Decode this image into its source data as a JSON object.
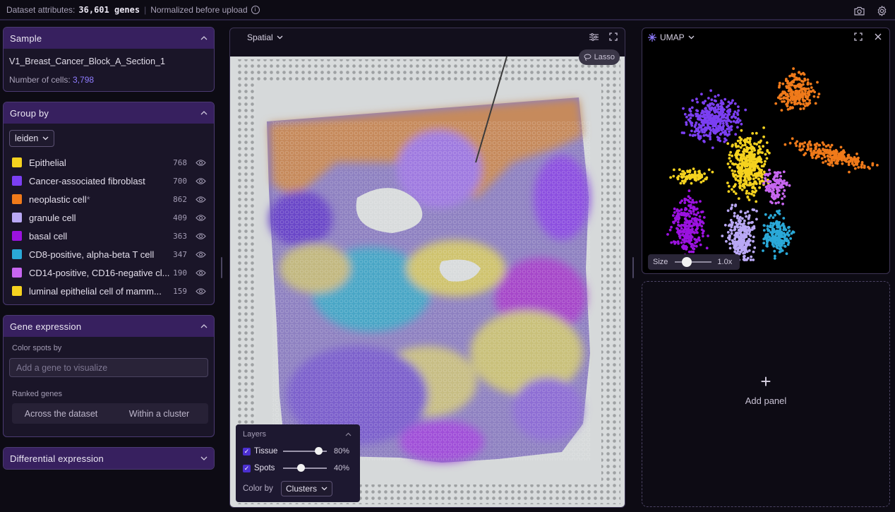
{
  "topbar": {
    "prefix": "Dataset attributes:",
    "genes": "36,601 genes",
    "separator": "|",
    "normalized": "Normalized before upload"
  },
  "sample": {
    "title": "Sample",
    "name": "V1_Breast_Cancer_Block_A_Section_1",
    "cells_label": "Number of cells:",
    "cells_value": "3,798"
  },
  "group_by": {
    "title": "Group by",
    "selected": "leiden",
    "groups": [
      {
        "label": "Epithelial",
        "count": "768",
        "color": "#f5d21f"
      },
      {
        "label": "Cancer-associated fibroblast",
        "count": "700",
        "color": "#7b3ff2"
      },
      {
        "label": "neoplastic cell",
        "asterisk": "*",
        "count": "862",
        "color": "#f07a1a"
      },
      {
        "label": "granule cell",
        "count": "409",
        "color": "#b9a8f5"
      },
      {
        "label": "basal cell",
        "count": "363",
        "color": "#9b12e0"
      },
      {
        "label": "CD8-positive, alpha-beta T cell",
        "count": "347",
        "color": "#2aa9d8"
      },
      {
        "label": "CD14-positive, CD16-negative cl...",
        "count": "190",
        "color": "#c766f0"
      },
      {
        "label": "luminal epithelial cell of mamm...",
        "count": "159",
        "color": "#f5d21f"
      }
    ]
  },
  "gene_expression": {
    "title": "Gene expression",
    "color_spots_label": "Color spots by",
    "input_placeholder": "Add a gene to visualize",
    "ranked_label": "Ranked genes",
    "tab_across": "Across the dataset",
    "tab_within": "Within a cluster"
  },
  "differential": {
    "title": "Differential expression"
  },
  "spatial": {
    "title": "Spatial",
    "lasso": "Lasso",
    "layers_title": "Layers",
    "tissue_label": "Tissue",
    "tissue_pct": "80%",
    "tissue_value": 0.8,
    "spots_label": "Spots",
    "spots_pct": "40%",
    "spots_value": 0.4,
    "colorby_label": "Color by",
    "colorby_value": "Clusters"
  },
  "umap": {
    "title": "UMAP",
    "size_label": "Size",
    "size_value": "1.0x"
  },
  "add_panel": {
    "label": "Add panel"
  },
  "colors": {
    "accent": "#8f7cff",
    "panel_header": "#37205f"
  }
}
